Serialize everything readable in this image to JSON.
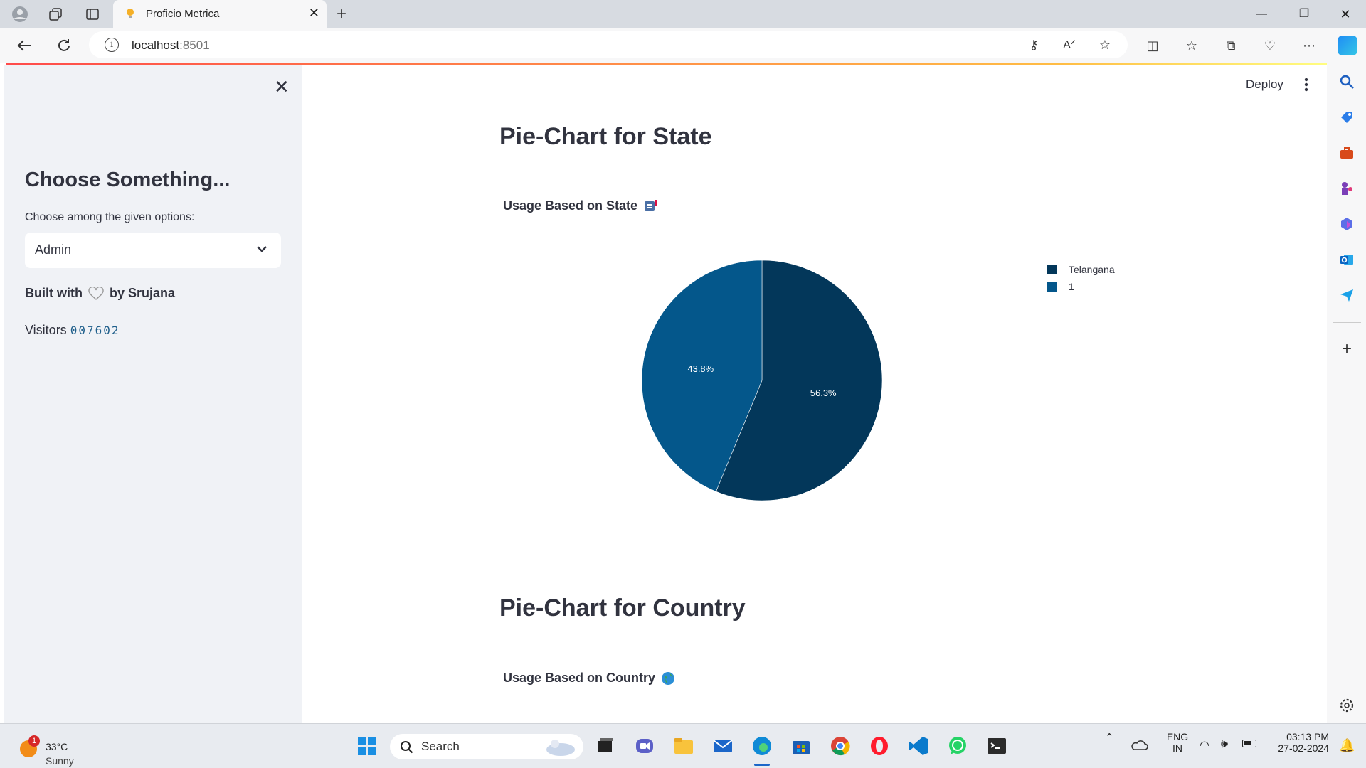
{
  "browser": {
    "tab_title": "Proficio Metrica",
    "url_host": "localhost",
    "url_port": ":8501"
  },
  "sidebar": {
    "heading": "Choose Something...",
    "select_label": "Choose among the given options:",
    "select_value": "Admin",
    "built_prefix": "Built with",
    "built_suffix": "by Srujana",
    "visitors_label": "Visitors",
    "visitors_count": "007602"
  },
  "header": {
    "deploy_label": "Deploy"
  },
  "main": {
    "state_title": "Pie-Chart for State",
    "state_subtitle": "Usage Based on State",
    "country_title": "Pie-Chart for Country",
    "country_subtitle": "Usage Based on Country"
  },
  "chart_data": {
    "type": "pie",
    "title": "",
    "categories": [
      "Telangana",
      "1"
    ],
    "values": [
      56.3,
      43.8
    ],
    "value_labels": [
      "56.3%",
      "43.8%"
    ],
    "colors": [
      "#03375a",
      "#04578b"
    ],
    "legend": "top-right"
  },
  "taskbar": {
    "temperature": "33°C",
    "condition": "Sunny",
    "notification_badge": "1",
    "search_placeholder": "Search",
    "lang_1": "ENG",
    "lang_2": "IN",
    "time": "03:13 PM",
    "date": "27-02-2024"
  },
  "colors": {
    "accent": "#ff4b4b",
    "sidebar_bg": "#f0f2f6"
  }
}
